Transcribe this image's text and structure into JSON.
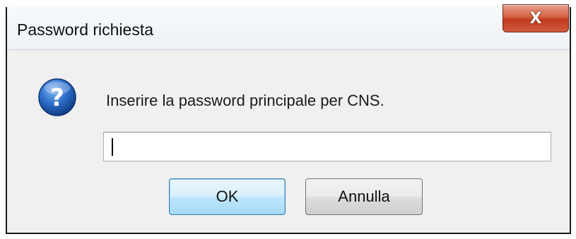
{
  "window": {
    "title": "Password richiesta",
    "close_glyph": "X"
  },
  "dialog": {
    "icon": "question-icon",
    "message": "Inserire la password principale per CNS.",
    "password_value": "",
    "password_placeholder": ""
  },
  "buttons": {
    "ok_label": "OK",
    "cancel_label": "Annulla"
  },
  "colors": {
    "accent": "#3c7fb1",
    "close_red": "#c0391f",
    "icon_blue": "#1f5fb8"
  }
}
